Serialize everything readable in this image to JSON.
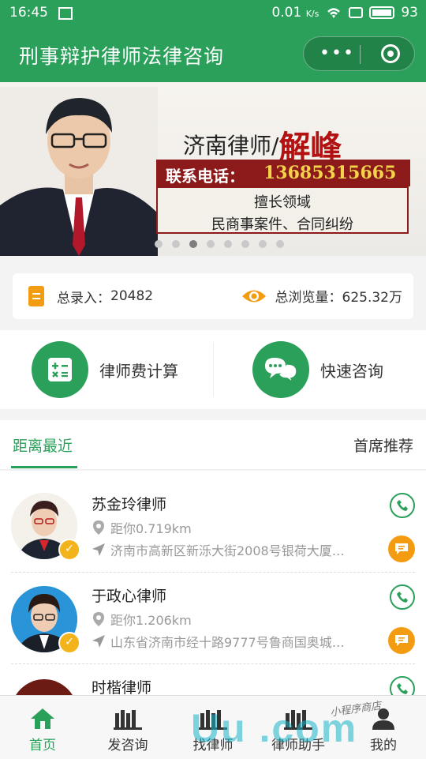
{
  "status": {
    "time": "16:45",
    "speed": "0.01",
    "speed_unit": "K/s",
    "battery": "93"
  },
  "app": {
    "title": "刑事辩护律师法律咨询",
    "menu_icon": "dots-icon",
    "close_icon": "target-icon"
  },
  "banner": {
    "city_title": "济南律师/",
    "name": "解峰",
    "phone_label": "联系电话：",
    "phone": "13685315665",
    "spec_title": "擅长领域",
    "spec_text": "民商事案件、合同纠纷",
    "dots": 8,
    "active_dot": 3
  },
  "stats": {
    "records_label": "总录入：",
    "records": "20482",
    "views_label": "总浏览量：",
    "views": "625.32万"
  },
  "actions": [
    {
      "label": "律师费计算",
      "icon": "calculator-icon"
    },
    {
      "label": "快速咨询",
      "icon": "chat-bubbles-icon"
    }
  ],
  "tabs": {
    "nearest": "距离最近",
    "recommended": "首席推荐"
  },
  "lawyers": [
    {
      "name": "苏金玲律师",
      "distance": "距你0.719km",
      "address": "济南市高新区新泺大街2008号银荷大厦…"
    },
    {
      "name": "于政心律师",
      "distance": "距你1.206km",
      "address": "山东省济南市经十路9777号鲁商国奥城…"
    },
    {
      "name": "时楷律师",
      "distance": "",
      "address": ""
    }
  ],
  "nav": [
    {
      "label": "首页",
      "icon": "home-icon"
    },
    {
      "label": "发咨询",
      "icon": "books-icon"
    },
    {
      "label": "找律师",
      "icon": "books-icon"
    },
    {
      "label": "律师助手",
      "icon": "books-icon"
    },
    {
      "label": "我的",
      "icon": "user-icon"
    }
  ],
  "watermark": {
    "text": "小程序商店",
    "brand": "Uu .com"
  },
  "colors": {
    "primary": "#2aa05a",
    "accent": "#f39c12",
    "banner_red": "#8d1a1a"
  }
}
